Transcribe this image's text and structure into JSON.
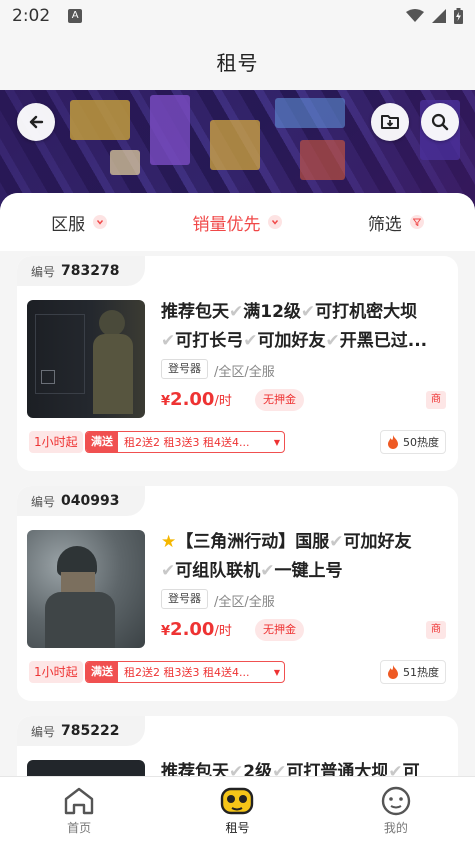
{
  "status": {
    "time": "2:02",
    "notif_letter": "A"
  },
  "header": {
    "title": "租号"
  },
  "filters": [
    {
      "label": "区服",
      "active": false
    },
    {
      "label": "销量优先",
      "active": true
    },
    {
      "label": "筛选",
      "active": false
    }
  ],
  "listings": [
    {
      "num_label": "编号",
      "num": "783278",
      "title_segments": [
        "推荐包天",
        "满12级",
        "可打机密大坝",
        "可打长弓",
        "可加好友",
        "开黑已过..."
      ],
      "launcher_tag": "登号器",
      "region": "/全区/全服",
      "currency": "¥",
      "price": "2.00",
      "unit": "/时",
      "deposit": "无押金",
      "shop_badge": "商",
      "min_rent": "1小时起",
      "promo_label": "满送",
      "promo_text": "租2送2  租3送3  租4送4...",
      "heat": "50热度"
    },
    {
      "num_label": "编号",
      "num": "040993",
      "title_segments": [
        "【三角洲行动】国服",
        "可加好友",
        "可组队联机",
        "一键上号"
      ],
      "launcher_tag": "登号器",
      "region": "/全区/全服",
      "currency": "¥",
      "price": "2.00",
      "unit": "/时",
      "deposit": "无押金",
      "shop_badge": "商",
      "min_rent": "1小时起",
      "promo_label": "满送",
      "promo_text": "租2送2  租3送3  租4送4...",
      "heat": "51热度"
    },
    {
      "num_label": "编号",
      "num": "785222",
      "title_segments": [
        "推荐包天",
        "2级",
        "可打普通大坝",
        "可"
      ]
    }
  ],
  "tabs": [
    {
      "label": "首页",
      "icon": "home-icon",
      "active": false
    },
    {
      "label": "租号",
      "icon": "gamepad-icon",
      "active": true
    },
    {
      "label": "我的",
      "icon": "profile-icon",
      "active": false
    }
  ],
  "colors": {
    "accent": "#f04848",
    "tab_active_icon": "#f5c518"
  }
}
